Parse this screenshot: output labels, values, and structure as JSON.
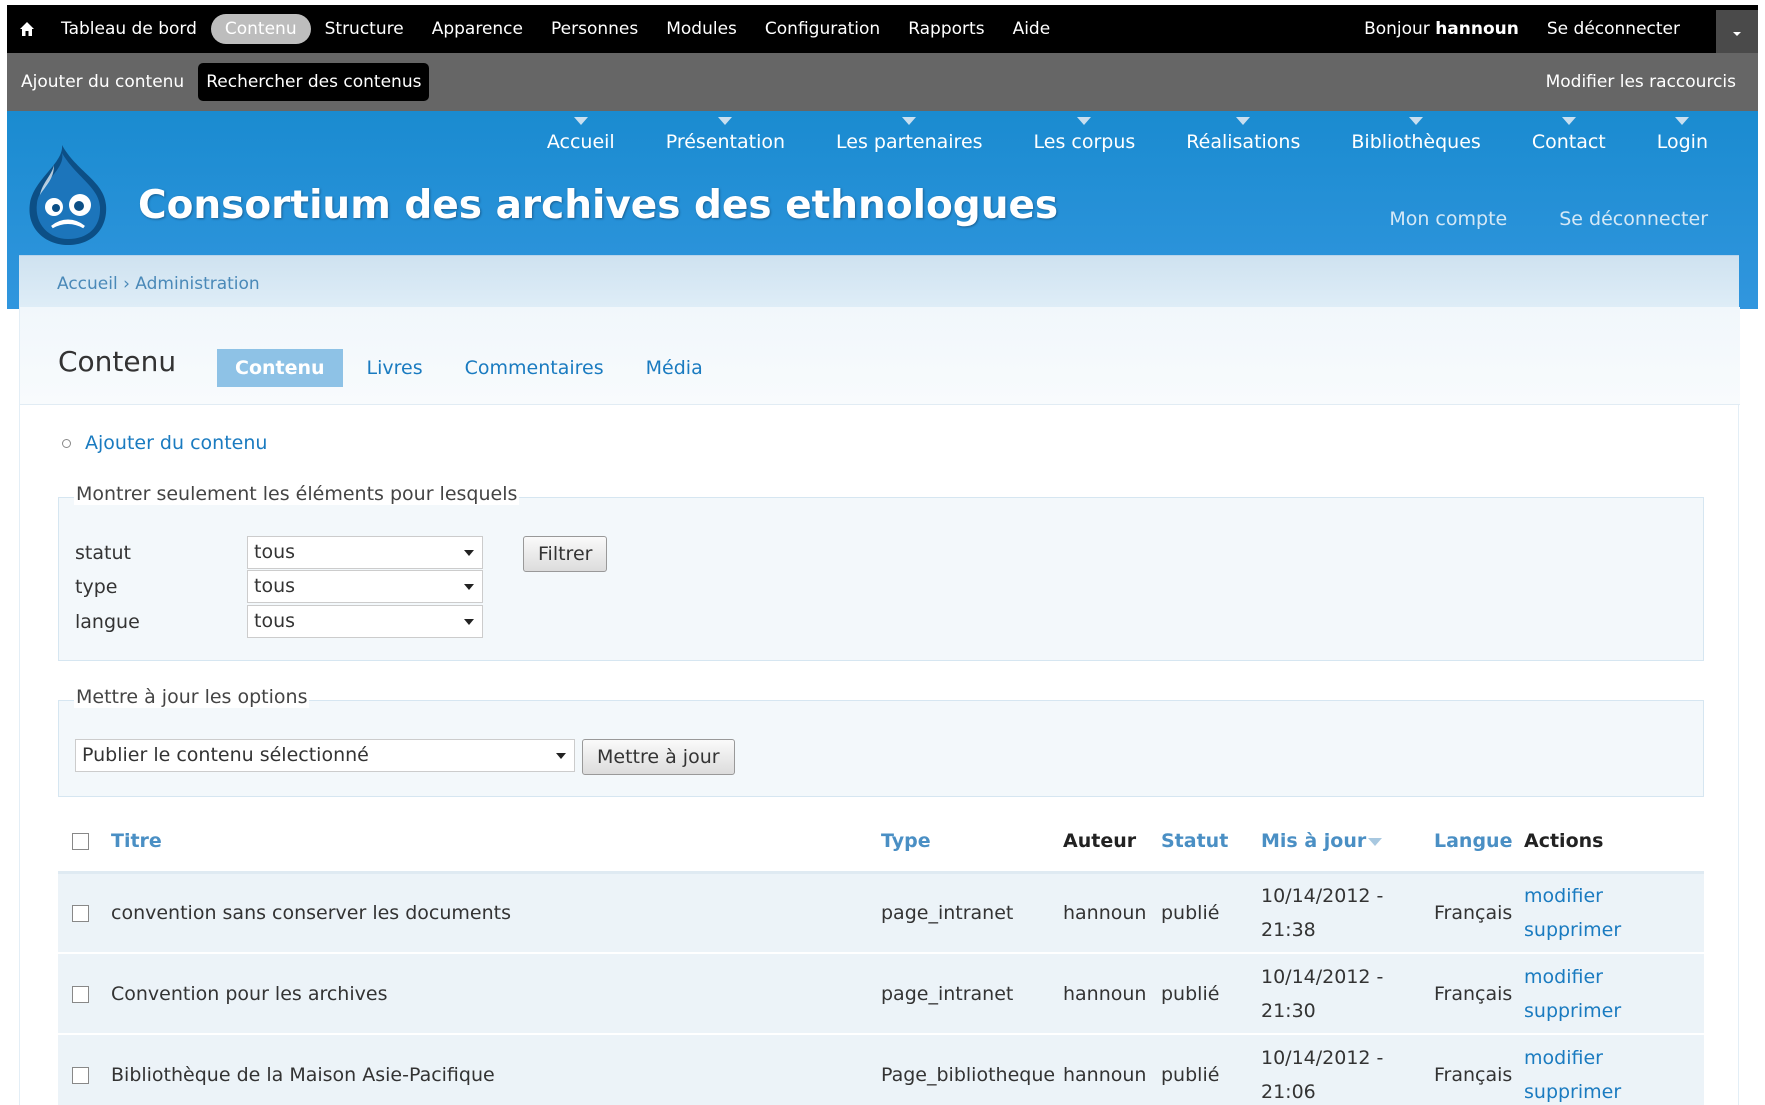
{
  "toolbar": {
    "items": [
      "Tableau de bord",
      "Contenu",
      "Structure",
      "Apparence",
      "Personnes",
      "Modules",
      "Configuration",
      "Rapports",
      "Aide"
    ],
    "greeting_prefix": "Bonjour ",
    "username": "hannoun",
    "logout": "Se déconnecter"
  },
  "shortcuts": {
    "items": [
      "Ajouter du contenu",
      "Rechercher des contenus"
    ],
    "edit": "Modifier les raccourcis"
  },
  "header": {
    "nav": [
      "Accueil",
      "Présentation",
      "Les partenaires",
      "Les corpus",
      "Réalisations",
      "Bibliothèques",
      "Contact",
      "Login"
    ],
    "site_name": "Consortium des archives des ethnologues",
    "secondary": [
      "Mon compte",
      "Se déconnecter"
    ]
  },
  "breadcrumb": "Accueil › Administration",
  "page": {
    "title": "Contenu",
    "tabs": [
      "Contenu",
      "Livres",
      "Commentaires",
      "Média"
    ],
    "add_link": "Ajouter du contenu"
  },
  "filter": {
    "legend": "Montrer seulement les éléments pour lesquels",
    "fields": [
      {
        "label": "statut",
        "value": "tous"
      },
      {
        "label": "type",
        "value": "tous"
      },
      {
        "label": "langue",
        "value": "tous"
      }
    ],
    "button": "Filtrer"
  },
  "update": {
    "legend": "Mettre à jour les options",
    "select_value": "Publier le contenu sélectionné",
    "button": "Mettre à jour"
  },
  "table": {
    "headers": {
      "title": "Titre",
      "type": "Type",
      "author": "Auteur",
      "status": "Statut",
      "updated": "Mis à jour",
      "language": "Langue",
      "actions": "Actions"
    },
    "rows": [
      {
        "title": "convention sans conserver les documents",
        "type": "page_intranet",
        "author": "hannoun",
        "status": "publié",
        "date": "10/14/2012 -",
        "time": "21:38",
        "language": "Français",
        "edit": "modifier",
        "delete": "supprimer"
      },
      {
        "title": "Convention pour les archives",
        "type": "page_intranet",
        "author": "hannoun",
        "status": "publié",
        "date": "10/14/2012 -",
        "time": "21:30",
        "language": "Français",
        "edit": "modifier",
        "delete": "supprimer"
      },
      {
        "title": "Bibliothèque de la Maison Asie-Pacifique",
        "type": "Page_bibliotheque",
        "author": "hannoun",
        "status": "publié",
        "date": "10/14/2012 -",
        "time": "21:06",
        "language": "Français",
        "edit": "modifier",
        "delete": "supprimer"
      }
    ]
  }
}
